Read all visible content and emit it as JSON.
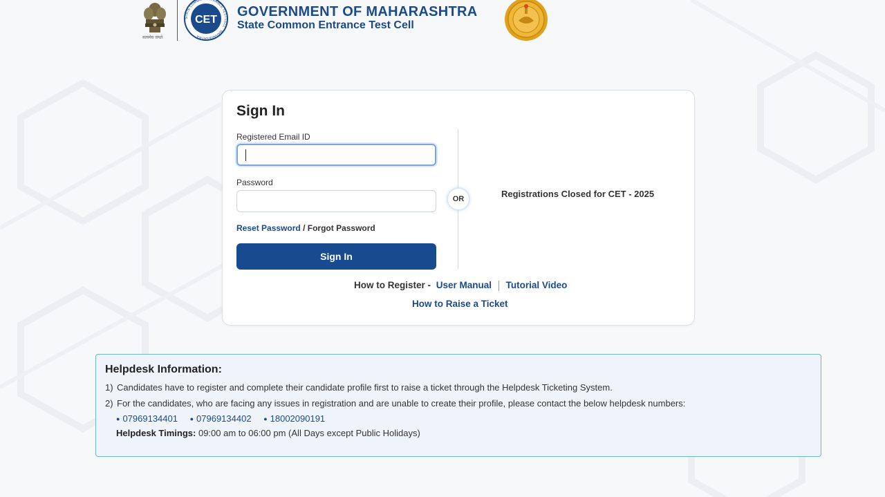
{
  "header": {
    "title": "GOVERNMENT OF MAHARASHTRA",
    "subtitle": "State Common Entrance Test Cell",
    "emblem_caption": "सत्यमेव जयते",
    "cet_logo_text": "CET",
    "cet_ring_text": "STATE COMMON ENTRANCE TEST CELL · MAHARASHTRA"
  },
  "signin": {
    "title": "Sign In",
    "email_label": "Registered Email ID",
    "email_value": "",
    "password_label": "Password",
    "password_value": "",
    "reset_link": "Reset Password",
    "divider": "/",
    "forgot_link": "Forgot Password",
    "button": "Sign In",
    "or_label": "OR",
    "registration_status": "Registrations Closed for CET - 2025",
    "how_to_register": "How to Register -",
    "user_manual": "User Manual",
    "tutorial_video": "Tutorial Video",
    "raise_ticket": "How to Raise a Ticket"
  },
  "helpdesk": {
    "title": "Helpdesk Information:",
    "items": [
      {
        "num": "1)",
        "text": "Candidates have to register and complete their candidate profile first to raise a ticket through the Helpdesk Ticketing System."
      },
      {
        "num": "2)",
        "text": "For the candidates, who are facing any issues in registration and are unable to create their profile, please contact the below helpdesk numbers:"
      }
    ],
    "phones": [
      "07969134401",
      "07969134402",
      "18002090191"
    ],
    "timings_label": "Helpdesk Timings:",
    "timings_value": "09:00 am to 06:00 pm (All Days except Public Holidays)"
  },
  "colors": {
    "brand_blue": "#174a8e",
    "link_blue": "#1b4a8c",
    "helpdesk_bg": "#eef4fa",
    "helpdesk_border": "#6fb8b6",
    "seal_gold": "#e0a21c"
  }
}
